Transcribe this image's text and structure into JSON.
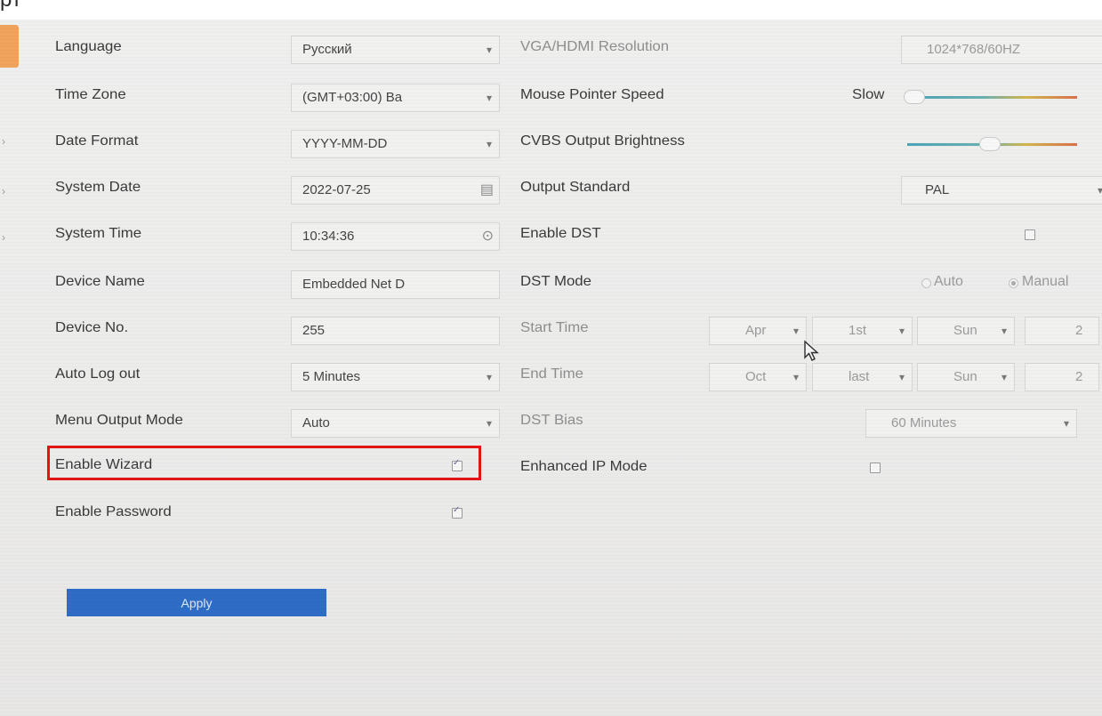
{
  "caption": "рт",
  "left": {
    "language": {
      "label": "Language",
      "value": "Русский"
    },
    "time_zone": {
      "label": "Time Zone",
      "value": "(GMT+03:00) Ba"
    },
    "date_format": {
      "label": "Date Format",
      "value": "YYYY-MM-DD"
    },
    "system_date": {
      "label": "System Date",
      "value": "2022-07-25"
    },
    "system_time": {
      "label": "System Time",
      "value": "10:34:36"
    },
    "device_name": {
      "label": "Device Name",
      "value": "Embedded Net D"
    },
    "device_no": {
      "label": "Device No.",
      "value": "255"
    },
    "auto_logout": {
      "label": "Auto Log out",
      "value": "5 Minutes"
    },
    "menu_output_mode": {
      "label": "Menu Output Mode",
      "value": "Auto"
    },
    "enable_wizard": {
      "label": "Enable Wizard",
      "checked": true
    },
    "enable_password": {
      "label": "Enable Password",
      "checked": true
    },
    "apply_label": "Apply"
  },
  "right": {
    "vga_hdmi": {
      "label": "VGA/HDMI Resolution",
      "value": "1024*768/60HZ"
    },
    "mouse_speed": {
      "label": "Mouse Pointer Speed",
      "slow_label": "Slow",
      "level": 0.0
    },
    "cvbs_brightness": {
      "label": "CVBS Output Brightness",
      "level": 0.5
    },
    "output_standard": {
      "label": "Output Standard",
      "value": "PAL"
    },
    "enable_dst": {
      "label": "Enable DST",
      "checked": false
    },
    "dst_mode": {
      "label": "DST Mode",
      "auto_label": "Auto",
      "manual_label": "Manual",
      "selected": "Manual"
    },
    "start_time": {
      "label": "Start Time",
      "month": "Apr",
      "week": "1st",
      "day": "Sun",
      "hour": "2"
    },
    "end_time": {
      "label": "End Time",
      "month": "Oct",
      "week": "last",
      "day": "Sun",
      "hour": "2"
    },
    "dst_bias": {
      "label": "DST Bias",
      "value": "60 Minutes"
    },
    "enhanced_ip": {
      "label": "Enhanced IP Mode",
      "checked": false
    }
  },
  "colors": {
    "highlight": "#e21515",
    "apply_button": "#2e6dc6",
    "tab_accent": "#f0a35c"
  }
}
